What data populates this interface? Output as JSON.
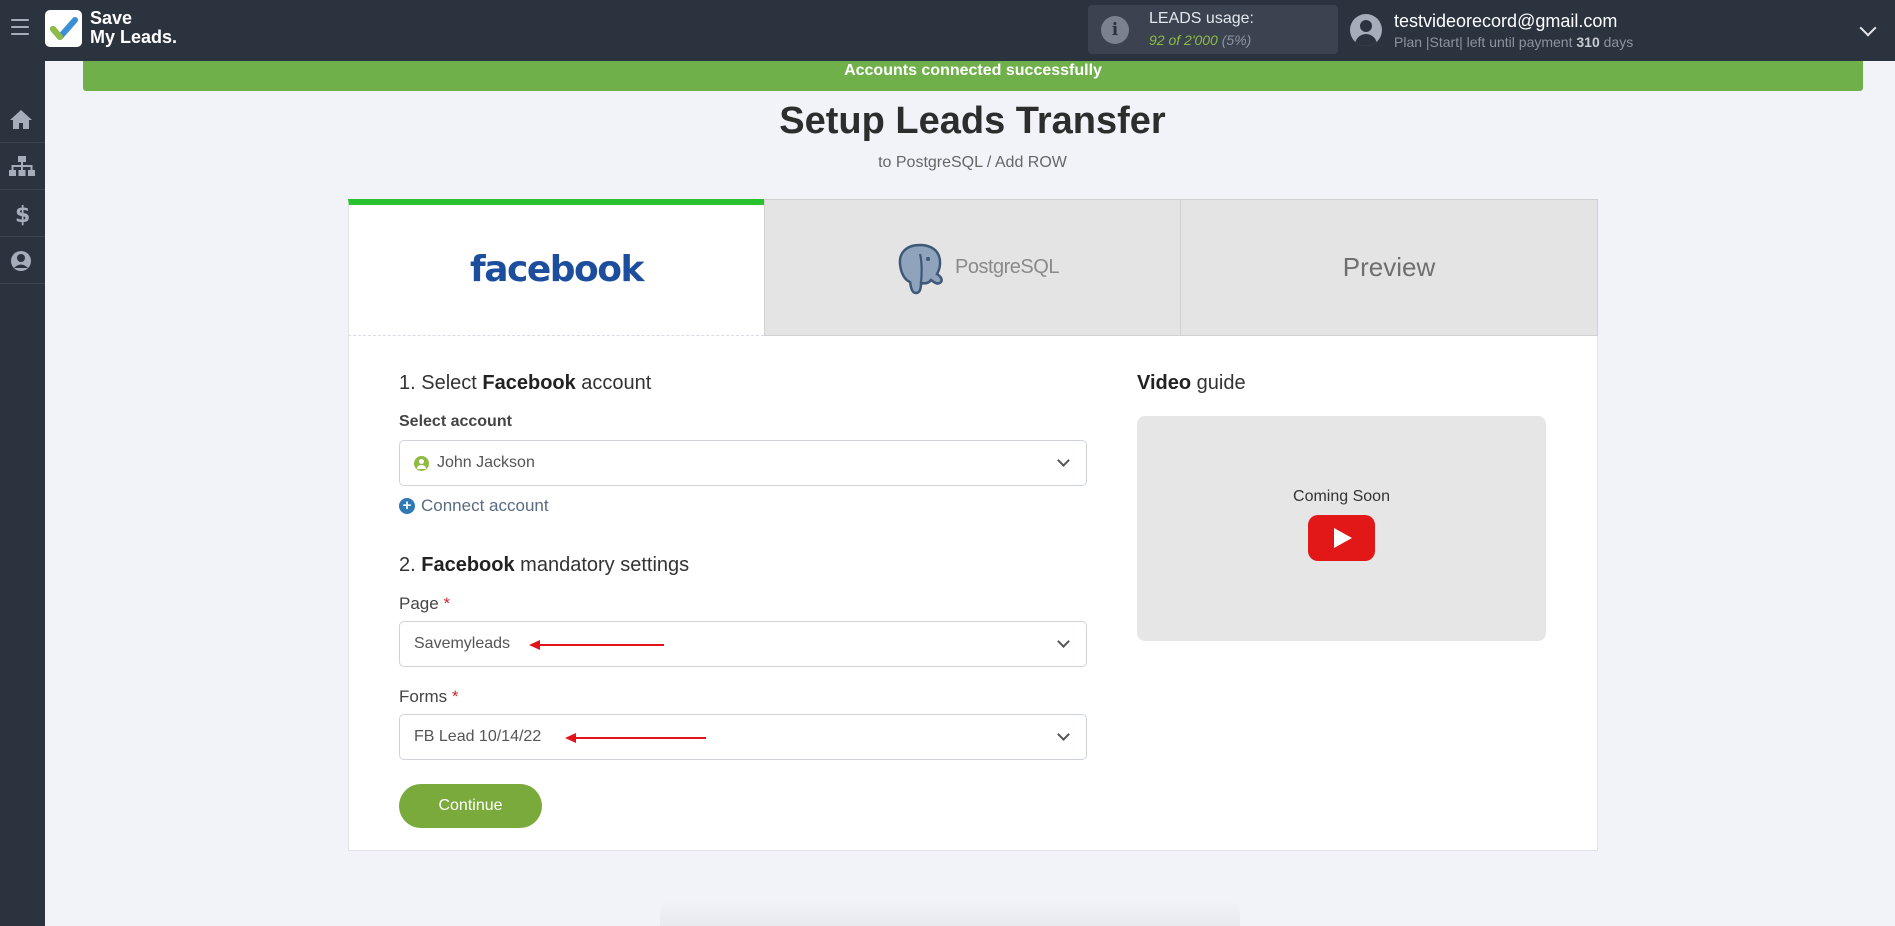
{
  "app": {
    "logo_line1": "Save",
    "logo_line2": "My Leads."
  },
  "header": {
    "usage_title": "LEADS usage:",
    "usage_count": "92 of 2'000",
    "usage_percent": "(5%)",
    "user_email": "testvideorecord@gmail.com",
    "plan_prefix": "Plan |Start| left until payment",
    "plan_days": "310",
    "plan_suffix": "days"
  },
  "sidebar": {
    "items": [
      {
        "icon": "home-icon"
      },
      {
        "icon": "sitemap-icon"
      },
      {
        "icon": "dollar-icon"
      },
      {
        "icon": "user-circle-icon"
      }
    ]
  },
  "banner": {
    "text": "Accounts connected successfully"
  },
  "page": {
    "title": "Setup Leads Transfer",
    "subtitle": "to PostgreSQL / Add ROW"
  },
  "tabs": [
    {
      "label": "facebook",
      "active": true
    },
    {
      "label": "PostgreSQL",
      "active": false
    },
    {
      "label": "Preview",
      "active": false
    }
  ],
  "section1": {
    "prefix": "1. Select ",
    "bold": "Facebook",
    "suffix": " account",
    "select_label": "Select account",
    "selected_account": "John Jackson",
    "connect_label": "Connect account"
  },
  "section2": {
    "prefix": "2. ",
    "bold": "Facebook",
    "suffix": " mandatory settings",
    "page_label": "Page",
    "page_value": "Savemyleads",
    "forms_label": "Forms",
    "forms_value": "FB Lead 10/14/22",
    "required_mark": "*"
  },
  "continue_label": "Continue",
  "video": {
    "title_bold": "Video",
    "title_rest": " guide",
    "coming_soon": "Coming Soon"
  },
  "colors": {
    "accent_green": "#6fb04a",
    "tab_active_bar": "#29c12d",
    "continue_button": "#7aaa3b",
    "topbar": "#2b333f",
    "arrow_red": "#e3131c"
  }
}
